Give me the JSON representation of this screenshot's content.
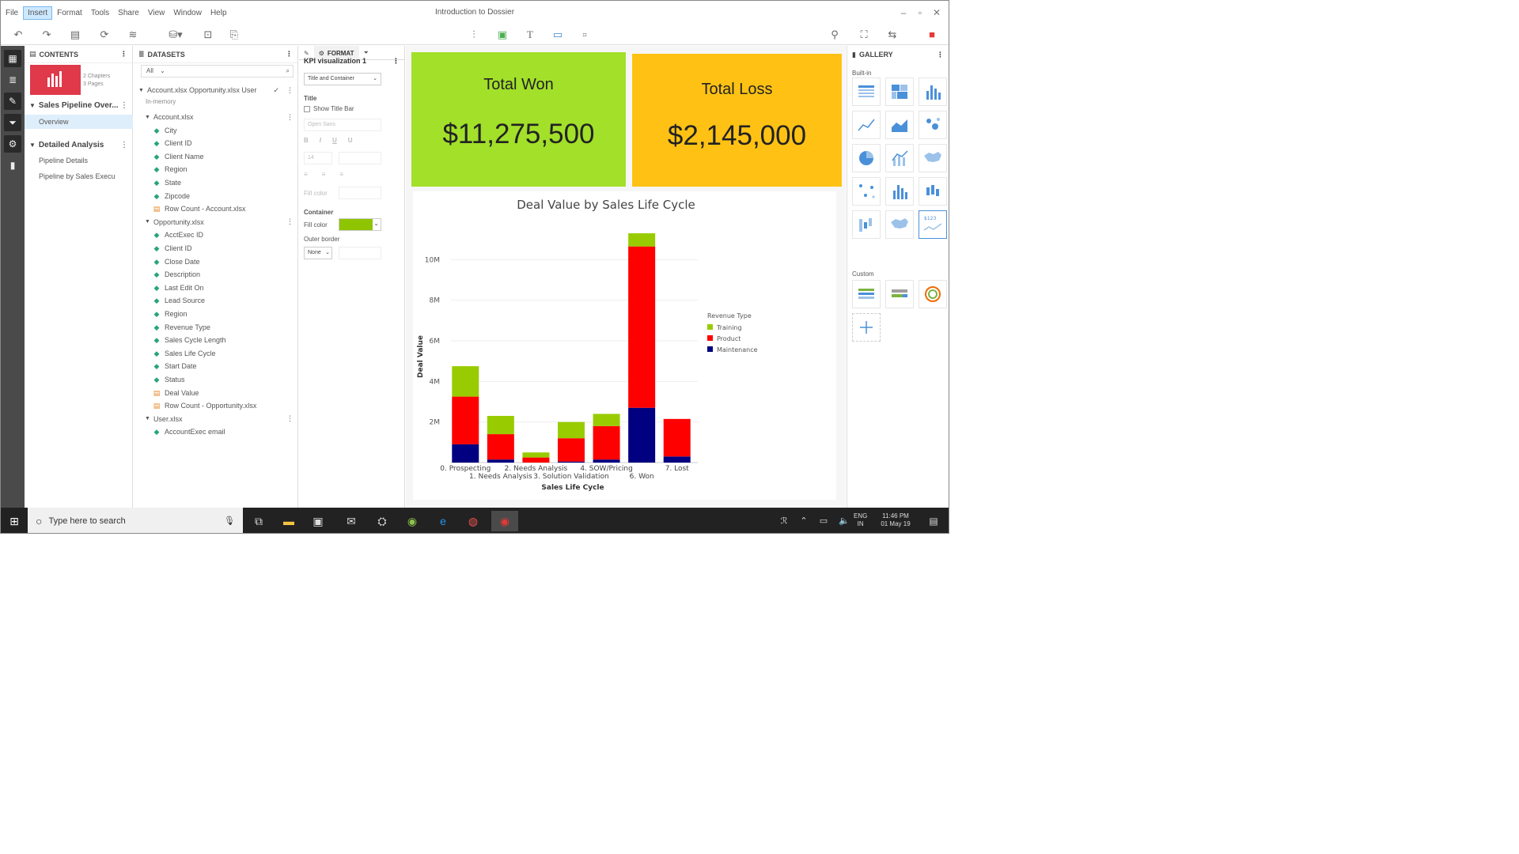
{
  "window": {
    "title": "Introduction to Dossier"
  },
  "menu": [
    "File",
    "Insert",
    "Format",
    "Tools",
    "Share",
    "View",
    "Window",
    "Help"
  ],
  "menu_active": "Insert",
  "contents": {
    "header": "CONTENTS",
    "meta_line1": "2 Chapters",
    "meta_line2": "3 Pages",
    "chapters": [
      {
        "title": "Sales Pipeline Over...",
        "pages": [
          "Overview"
        ]
      },
      {
        "title": "Detailed Analysis",
        "pages": [
          "Pipeline Details",
          "Pipeline by Sales Execu"
        ]
      }
    ]
  },
  "datasets": {
    "header": "DATASETS",
    "filter": "All",
    "source": "Account.xlsx Opportunity.xlsx User",
    "source_sub": "In-memory",
    "tables": [
      {
        "name": "Account.xlsx",
        "fields": [
          {
            "name": "City",
            "kind": "attr"
          },
          {
            "name": "Client ID",
            "kind": "attr"
          },
          {
            "name": "Client Name",
            "kind": "attr"
          },
          {
            "name": "Region",
            "kind": "attr"
          },
          {
            "name": "State",
            "kind": "attr"
          },
          {
            "name": "Zipcode",
            "kind": "attr"
          },
          {
            "name": "Row Count - Account.xlsx",
            "kind": "metric"
          }
        ]
      },
      {
        "name": "Opportunity.xlsx",
        "fields": [
          {
            "name": "AcctExec ID",
            "kind": "attr"
          },
          {
            "name": "Client ID",
            "kind": "attr"
          },
          {
            "name": "Close Date",
            "kind": "attr"
          },
          {
            "name": "Description",
            "kind": "attr"
          },
          {
            "name": "Last Edit On",
            "kind": "attr"
          },
          {
            "name": "Lead Source",
            "kind": "attr"
          },
          {
            "name": "Region",
            "kind": "attr"
          },
          {
            "name": "Revenue Type",
            "kind": "attr"
          },
          {
            "name": "Sales Cycle Length",
            "kind": "attr"
          },
          {
            "name": "Sales Life Cycle",
            "kind": "attr"
          },
          {
            "name": "Start Date",
            "kind": "attr"
          },
          {
            "name": "Status",
            "kind": "attr"
          },
          {
            "name": "Deal Value",
            "kind": "metric"
          },
          {
            "name": "Row Count - Opportunity.xlsx",
            "kind": "metric"
          }
        ]
      },
      {
        "name": "User.xlsx",
        "fields": [
          {
            "name": "AccountExec email",
            "kind": "attr"
          }
        ]
      }
    ]
  },
  "format": {
    "tab_label": "FORMAT",
    "viz_name": "KPI visualization 1",
    "target": "Title and Container",
    "title_section": "Title",
    "show_title_bar": "Show Title Bar",
    "font": "Open Sans",
    "font_size": "14",
    "bold": "B",
    "italic": "I",
    "underline": "U",
    "strike": "U",
    "fill_label": "Fill color",
    "container_section": "Container",
    "container_fill_label": "Fill color",
    "container_fill_color": "#8fc400",
    "outer_border_label": "Outer border",
    "outer_border_value": "None"
  },
  "kpi": [
    {
      "title": "Total Won",
      "value": "$11,275,500",
      "color": "#a2e02a"
    },
    {
      "title": "Total Loss",
      "value": "$2,145,000",
      "color": "#ffc214"
    }
  ],
  "chart_data": {
    "type": "bar",
    "stacked": true,
    "title": "Deal Value by Sales Life Cycle",
    "xlabel": "Sales Life Cycle",
    "ylabel": "Deal Value",
    "ylim": [
      0,
      12000000
    ],
    "yticks": [
      "2M",
      "4M",
      "6M",
      "8M",
      "10M"
    ],
    "yticks_values": [
      2000000,
      4000000,
      6000000,
      8000000,
      10000000
    ],
    "categories": [
      "0. Prospecting",
      "1. Needs Analysis",
      "2. Needs Analysis",
      "3. Solution Validation",
      "4. SOW/Pricing",
      "6. Won",
      "7. Lost"
    ],
    "legend_title": "Revenue Type",
    "legend_position": "right",
    "series": [
      {
        "name": "Maintenance",
        "color": "#000080",
        "values": [
          900000,
          150000,
          0,
          50000,
          150000,
          2700000,
          300000
        ]
      },
      {
        "name": "Product",
        "color": "#ff0000",
        "values": [
          2350000,
          1250000,
          250000,
          1150000,
          1650000,
          7950000,
          1850000
        ]
      },
      {
        "name": "Training",
        "color": "#99cc00",
        "values": [
          1500000,
          900000,
          250000,
          800000,
          600000,
          650000,
          0
        ]
      }
    ]
  },
  "gallery": {
    "header": "GALLERY",
    "builtin_label": "Built-in",
    "custom_label": "Custom",
    "thumb_label": "$123"
  },
  "taskbar": {
    "search_placeholder": "Type here to search",
    "lang_line1": "ENG",
    "lang_line2": "IN",
    "time": "11:46 PM",
    "date": "01 May 19"
  },
  "colors": {
    "accent": "#4a90d9",
    "rail": "#4a4a4a"
  }
}
